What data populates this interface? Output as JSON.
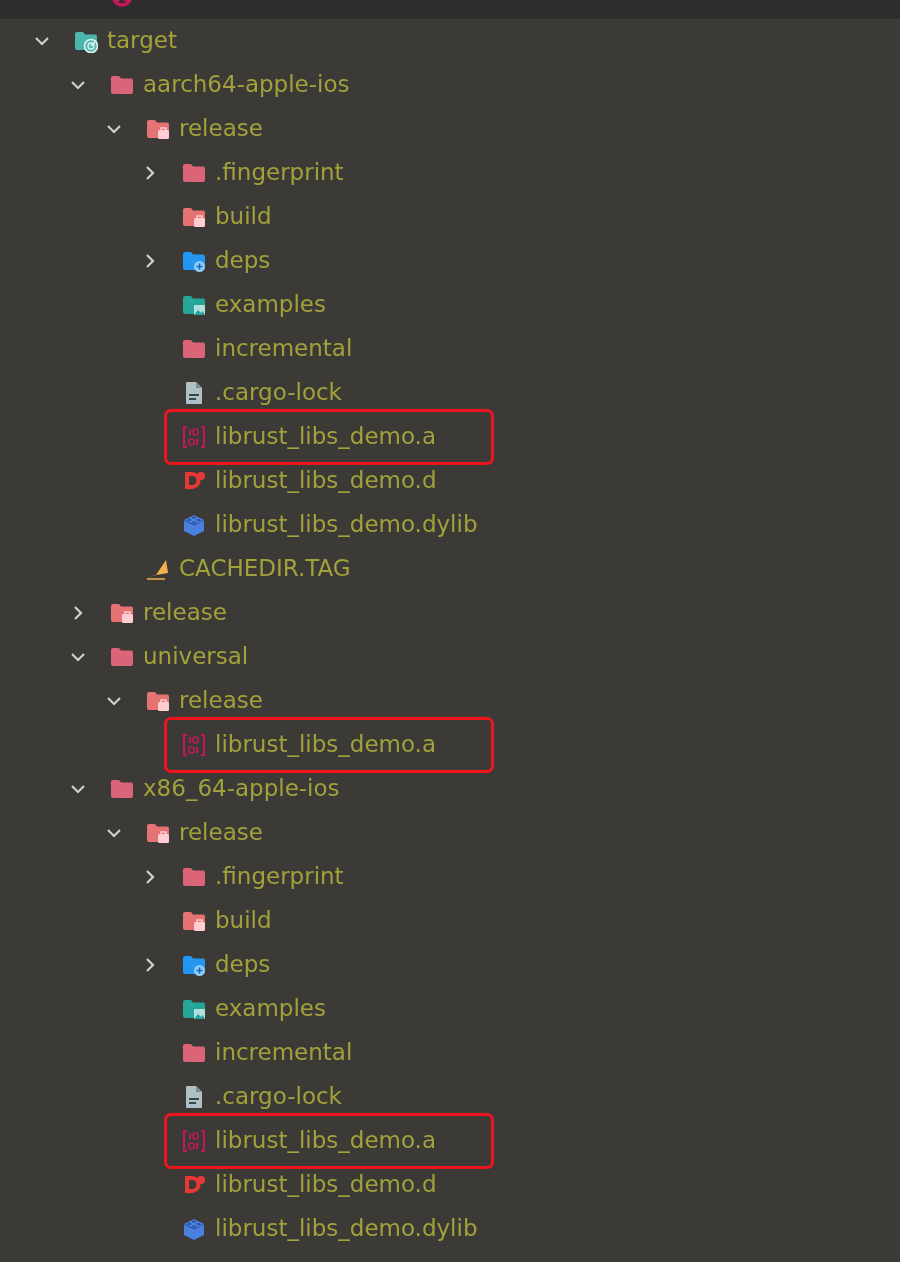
{
  "partial_row": {
    "kind": "rust-file"
  },
  "tree": [
    {
      "label": "target",
      "kind": "folder-target",
      "expanded": true,
      "children": [
        {
          "label": "aarch64-apple-ios",
          "kind": "folder",
          "expanded": true,
          "children": [
            {
              "label": "release",
              "kind": "folder-package",
              "expanded": true,
              "children": [
                {
                  "label": ".fingerprint",
                  "kind": "folder",
                  "expanded": false
                },
                {
                  "label": "build",
                  "kind": "folder-package"
                },
                {
                  "label": "deps",
                  "kind": "folder-deps",
                  "expanded": false
                },
                {
                  "label": "examples",
                  "kind": "folder-examples"
                },
                {
                  "label": "incremental",
                  "kind": "folder"
                },
                {
                  "label": ".cargo-lock",
                  "kind": "text-file"
                },
                {
                  "label": "librust_libs_demo.a",
                  "kind": "binary-file",
                  "highlighted": true
                },
                {
                  "label": "librust_libs_demo.d",
                  "kind": "d-file"
                },
                {
                  "label": "librust_libs_demo.dylib",
                  "kind": "dylib-file"
                }
              ]
            },
            {
              "label": "CACHEDIR.TAG",
              "kind": "tag-file"
            }
          ]
        },
        {
          "label": "release",
          "kind": "folder-package",
          "expanded": false
        },
        {
          "label": "universal",
          "kind": "folder",
          "expanded": true,
          "children": [
            {
              "label": "release",
              "kind": "folder-package",
              "expanded": true,
              "children": [
                {
                  "label": "librust_libs_demo.a",
                  "kind": "binary-file",
                  "highlighted": true
                }
              ]
            }
          ]
        },
        {
          "label": "x86_64-apple-ios",
          "kind": "folder",
          "expanded": true,
          "children": [
            {
              "label": "release",
              "kind": "folder-package",
              "expanded": true,
              "children": [
                {
                  "label": ".fingerprint",
                  "kind": "folder",
                  "expanded": false
                },
                {
                  "label": "build",
                  "kind": "folder-package"
                },
                {
                  "label": "deps",
                  "kind": "folder-deps",
                  "expanded": false
                },
                {
                  "label": "examples",
                  "kind": "folder-examples"
                },
                {
                  "label": "incremental",
                  "kind": "folder"
                },
                {
                  "label": ".cargo-lock",
                  "kind": "text-file"
                },
                {
                  "label": "librust_libs_demo.a",
                  "kind": "binary-file",
                  "highlighted": true
                },
                {
                  "label": "librust_libs_demo.d",
                  "kind": "d-file"
                },
                {
                  "label": "librust_libs_demo.dylib",
                  "kind": "dylib-file"
                }
              ]
            }
          ]
        }
      ]
    }
  ]
}
